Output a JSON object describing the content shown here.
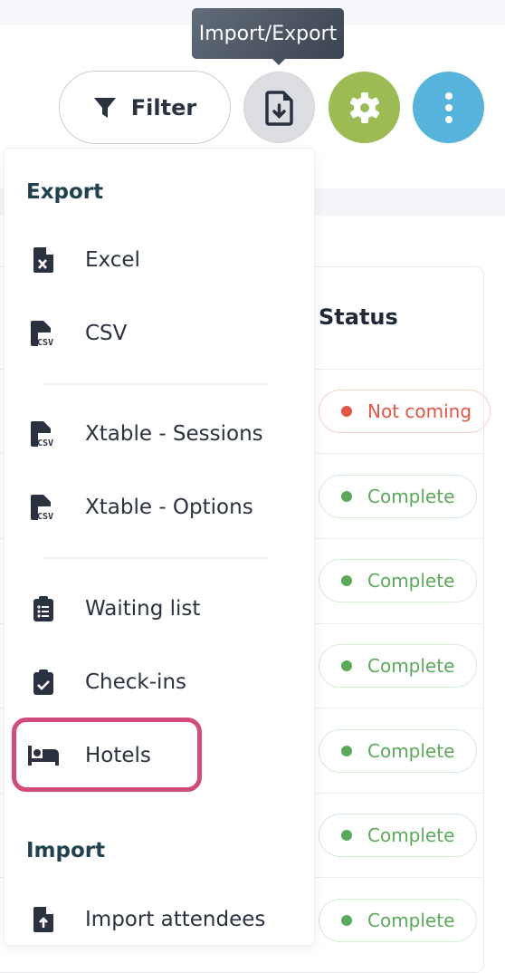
{
  "toolbar": {
    "filter_label": "Filter",
    "import_export_tooltip": "Import/Export"
  },
  "table": {
    "status_header": "Status",
    "rows": [
      {
        "status": "Not coming",
        "color": "#e25543"
      },
      {
        "status": "Complete",
        "color": "#5aaa5a"
      },
      {
        "status": "Complete",
        "color": "#5aaa5a"
      },
      {
        "status": "Complete",
        "color": "#5aaa5a"
      },
      {
        "status": "Complete",
        "color": "#5aaa5a"
      },
      {
        "status": "Complete",
        "color": "#5aaa5a"
      },
      {
        "status": "Complete",
        "color": "#5aaa5a"
      }
    ]
  },
  "menu": {
    "export_heading": "Export",
    "import_heading": "Import",
    "items": [
      {
        "label": "Excel",
        "icon": "file-excel-icon"
      },
      {
        "label": "CSV",
        "icon": "file-csv-icon"
      },
      {
        "label": "Xtable - Sessions",
        "icon": "file-csv-icon"
      },
      {
        "label": "Xtable - Options",
        "icon": "file-csv-icon"
      },
      {
        "label": "Waiting list",
        "icon": "clipboard-list-icon"
      },
      {
        "label": "Check-ins",
        "icon": "clipboard-check-icon"
      },
      {
        "label": "Hotels",
        "icon": "bed-icon",
        "highlighted": true
      },
      {
        "label": "Import attendees",
        "icon": "file-upload-icon"
      }
    ]
  },
  "colors": {
    "highlight": "#d14b7c",
    "settings": "#9cbb52",
    "more": "#56b4dc",
    "import_export": "#dcdde0"
  }
}
